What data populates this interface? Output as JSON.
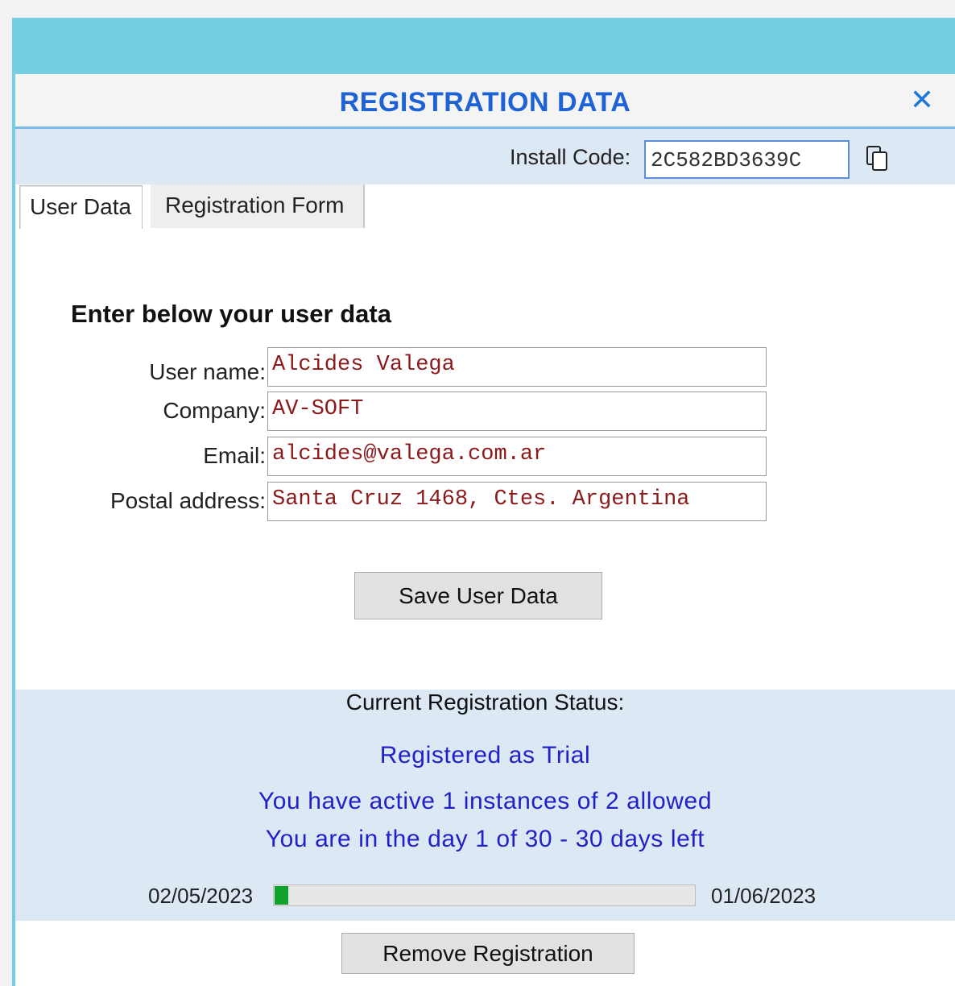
{
  "dialog": {
    "title": "REGISTRATION DATA",
    "close_glyph": "✕"
  },
  "install": {
    "label": "Install Code:",
    "value": "2C582BD3639C",
    "copy_icon": "copy-icon"
  },
  "tabs": [
    {
      "label": "User Data",
      "active": true
    },
    {
      "label": "Registration Form",
      "active": false
    }
  ],
  "form": {
    "heading": "Enter below your user data",
    "fields": [
      {
        "label": "User name:",
        "value": "Alcides Valega"
      },
      {
        "label": "Company:",
        "value": "AV-SOFT"
      },
      {
        "label": "Email:",
        "value": "alcides@valega.com.ar"
      },
      {
        "label": "Postal address:",
        "value": "Santa Cruz 1468, Ctes. Argentina"
      }
    ],
    "save_label": "Save User Data"
  },
  "status": {
    "heading": "Current Registration Status:",
    "registered_as": "Registered as Trial",
    "instances": "You have active 1 instances of 2 allowed",
    "days": "You are in the day 1 of 30 - 30 days left",
    "start_date": "02/05/2023",
    "end_date": "01/06/2023",
    "progress_fraction": 0.033,
    "progress_color": "#0da32b"
  },
  "remove_label": "Remove Registration",
  "colors": {
    "accent_bar": "#74cfe1",
    "title": "#1e63d6",
    "status_text": "#2121c8",
    "field_text": "#8b1a1a",
    "panel_bg": "#dce8f4"
  }
}
